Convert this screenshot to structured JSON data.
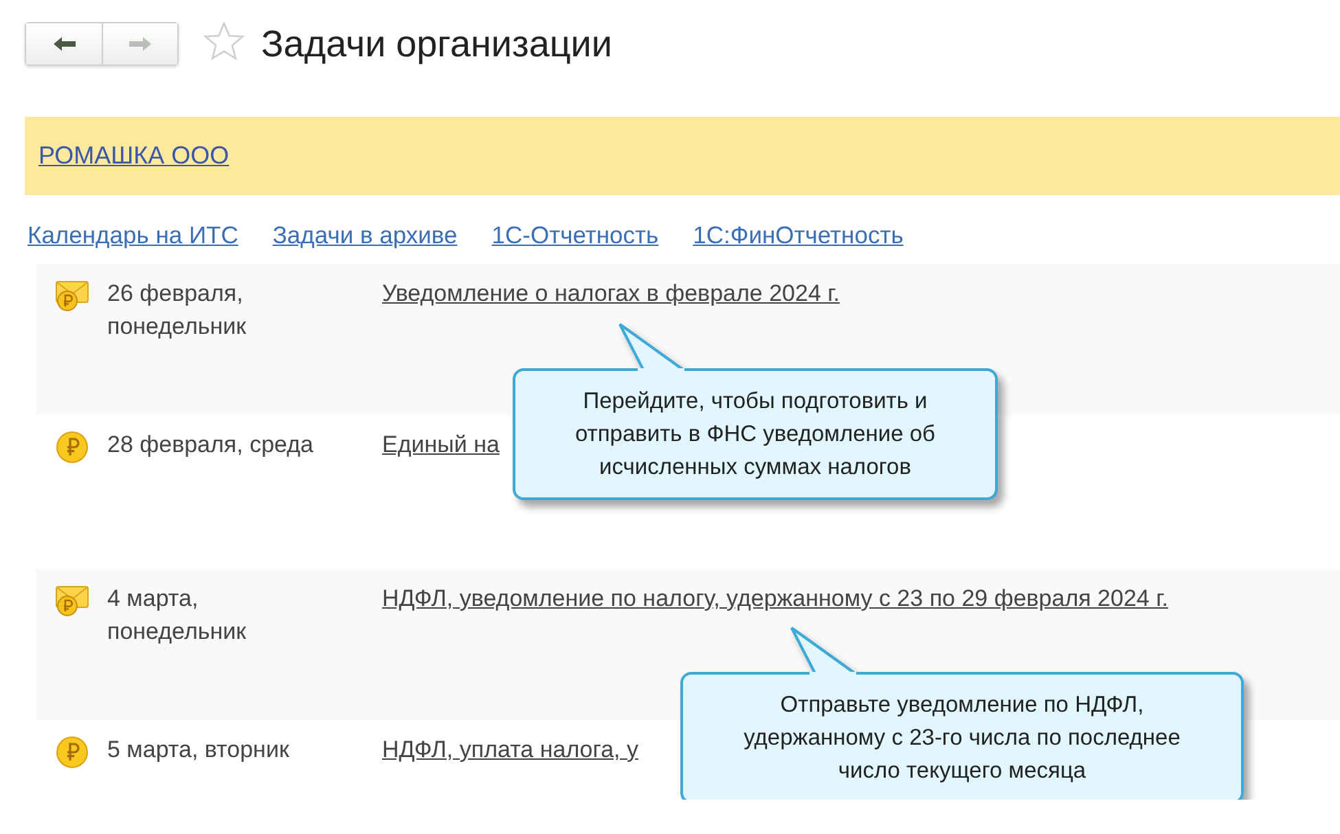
{
  "header": {
    "title": "Задачи организации",
    "favorite": false,
    "back_disabled": false,
    "forward_disabled": true
  },
  "organization": {
    "name": "РОМАШКА ООО"
  },
  "links": [
    "Календарь на ИТС",
    "Задачи в архиве",
    "1С-Отчетность",
    "1С:ФинОтчетность"
  ],
  "tasks": [
    {
      "kind": "notice",
      "date": "26 февраля, понедельник",
      "title": "Уведомление о налогах в феврале 2024 г.",
      "highlighted": true,
      "tooltip": "Перейдите, чтобы подготовить и отправить в ФНС уведомление об исчисленных суммах налогов"
    },
    {
      "kind": "payment",
      "date": "28 февраля, среда",
      "title": "Единый на",
      "highlighted": false
    },
    {
      "kind": "notice",
      "date": "4 марта, понедельник",
      "title": "НДФЛ, уведомление по налогу, удержанному с 23 по 29 февраля 2024 г.",
      "highlighted": true,
      "tooltip": "Отправьте уведомление по НДФЛ, удержанному с 23-го числа по последнее число текущего месяца"
    },
    {
      "kind": "payment",
      "date": "5 марта, вторник",
      "title": "НДФЛ, уплата налога, у",
      "highlighted": false
    }
  ]
}
